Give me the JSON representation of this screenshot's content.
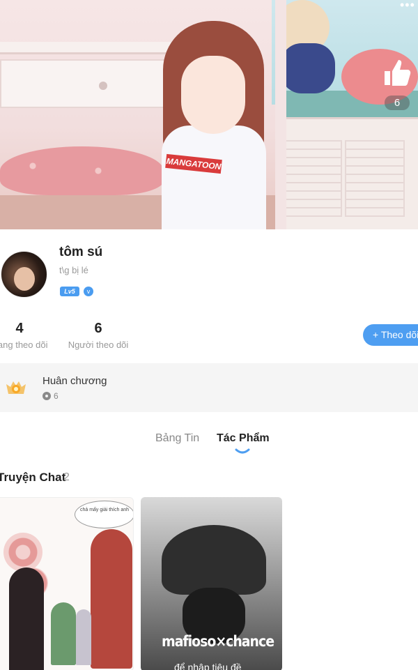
{
  "hero": {
    "like_count": "6",
    "shirt_logo": "MANGATOON"
  },
  "profile": {
    "username": "tôm sú",
    "bio": "t\\g bị lé",
    "level_badge": "Lv5",
    "vip_badge": "v"
  },
  "stats": {
    "following": {
      "value": "4",
      "label": "Đang theo dõi"
    },
    "followers": {
      "value": "6",
      "label": "Người theo dõi"
    }
  },
  "actions": {
    "follow_label": "+ Theo dõi"
  },
  "medals": {
    "title": "Huân chương",
    "count": "6"
  },
  "tabs": [
    {
      "label": "Bảng Tin",
      "active": false
    },
    {
      "label": "Tác Phẩm",
      "active": true
    }
  ],
  "section": {
    "title": "Truyện Chat",
    "count": "2"
  },
  "cards": [
    {
      "bubble_text": "chả mấy giải thích anh"
    },
    {
      "title": "mafioso×chance",
      "subtitle": "để nhập tiêu đề"
    }
  ],
  "colors": {
    "accent": "#4e9ef1",
    "medal_bg": "#f5f5f5",
    "muted_text": "#999999"
  }
}
